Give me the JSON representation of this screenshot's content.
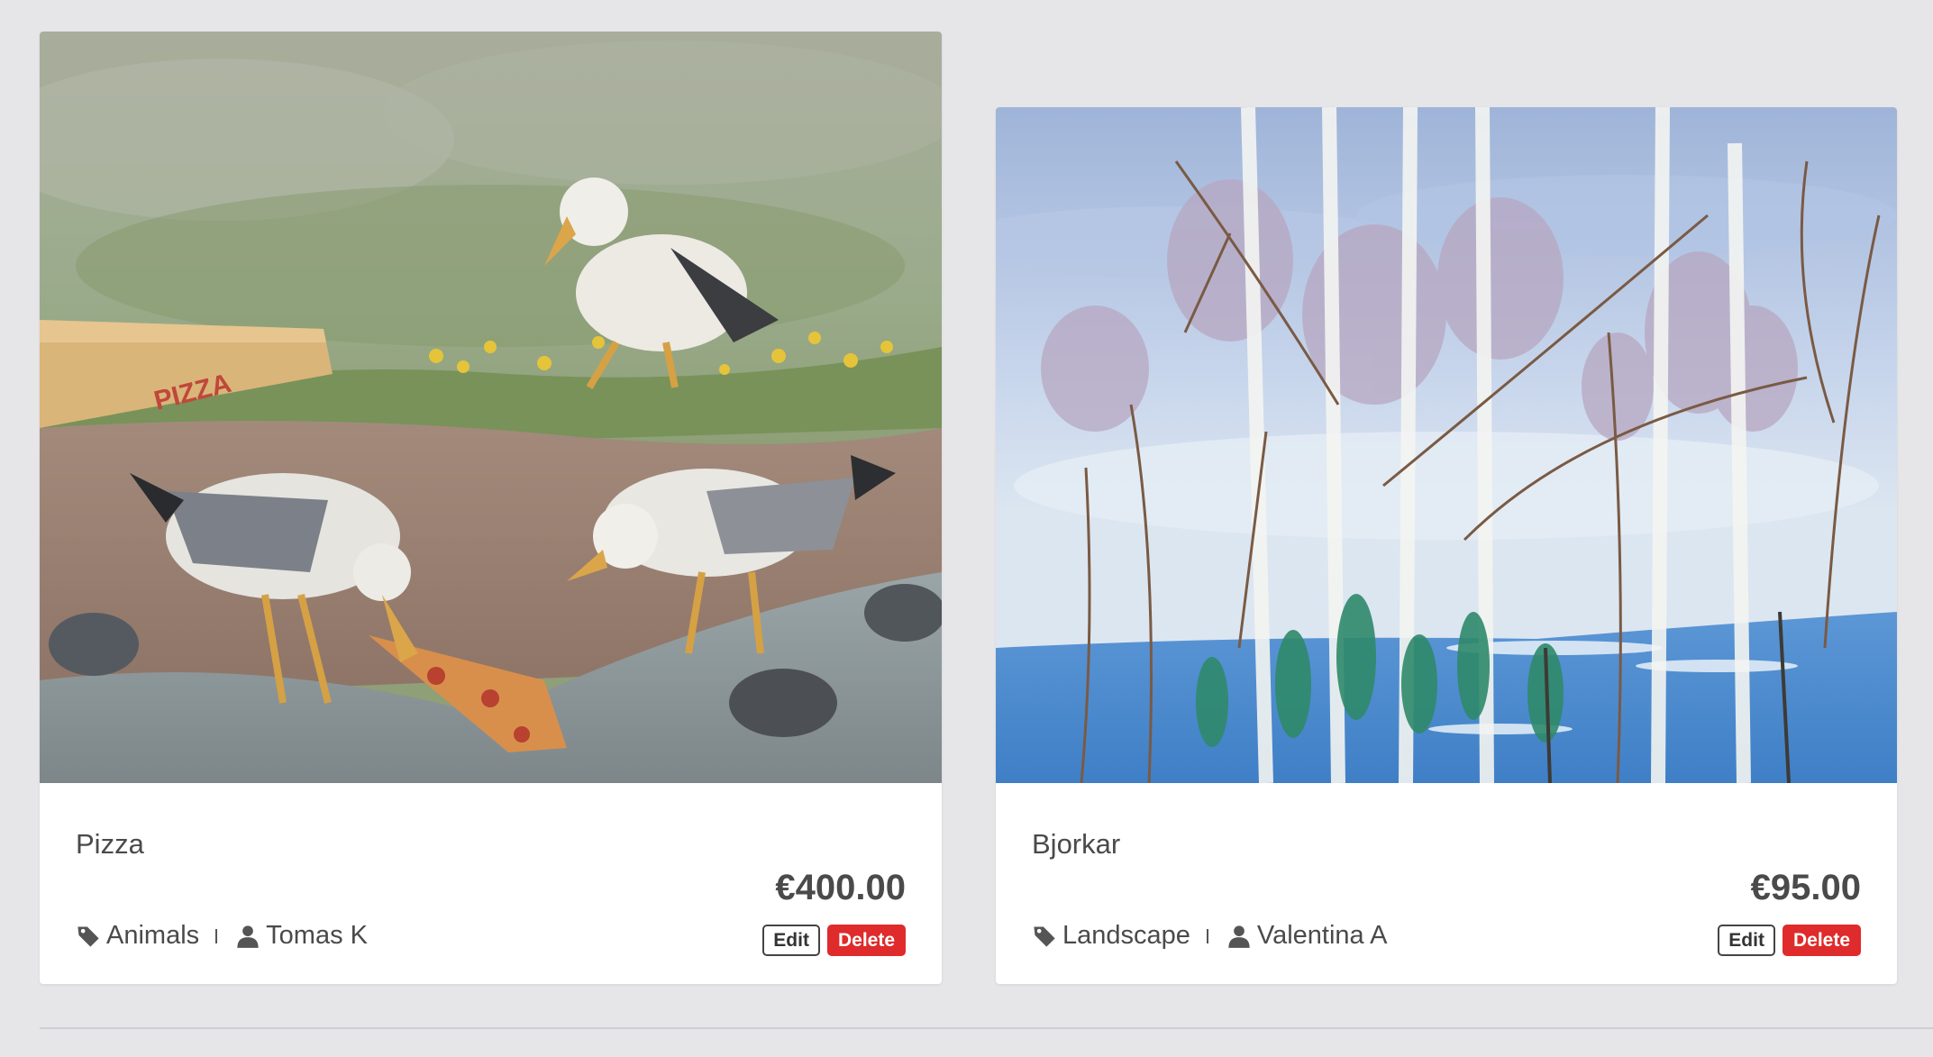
{
  "cards": [
    {
      "title": "Pizza",
      "price": "€400.00",
      "category": "Animals",
      "artist": "Tomas K",
      "edit_label": "Edit",
      "delete_label": "Delete",
      "image_subject": "oil painting of seagulls eating pizza on a shore",
      "box_text": "PIZZA"
    },
    {
      "title": "Bjorkar",
      "price": "€95.00",
      "category": "Landscape",
      "artist": "Valentina A",
      "edit_label": "Edit",
      "delete_label": "Delete",
      "image_subject": "watercolor of birch trees by blue water"
    }
  ],
  "colors": {
    "background": "#e6e6e9",
    "card": "#ffffff",
    "text": "#4a4a4a",
    "delete": "#df2b2b"
  },
  "icons": {
    "category": "tag-icon",
    "artist": "user-icon"
  }
}
